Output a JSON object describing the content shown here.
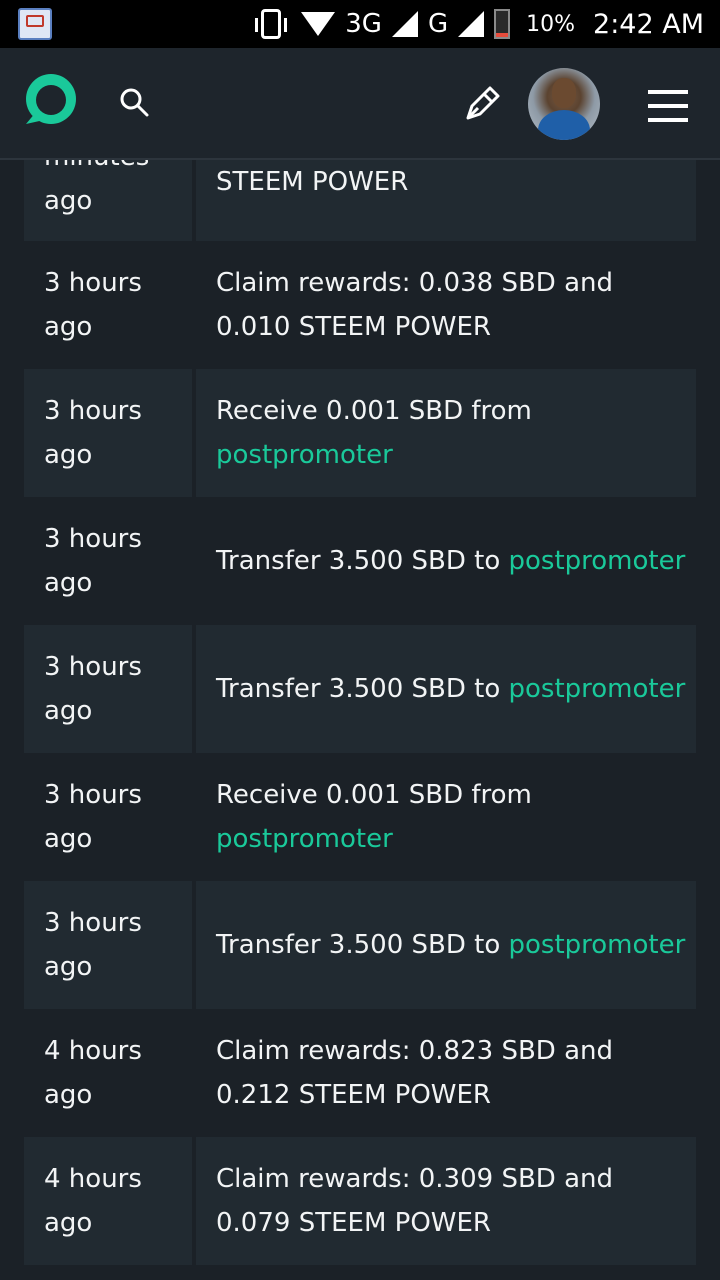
{
  "status_bar": {
    "network": "3G",
    "network2": "G",
    "battery": "10%",
    "time": "2:42 AM"
  },
  "header": {
    "logo_icon": "steemit-logo-icon",
    "accent": "#1ac99a"
  },
  "transactions": [
    {
      "time": "minutes ago",
      "text": "STEEM POWER",
      "link": "",
      "alt": true
    },
    {
      "time": "3 hours ago",
      "text": "Claim rewards: 0.038 SBD and 0.010 STEEM POWER",
      "link": "",
      "alt": false
    },
    {
      "time": "3 hours ago",
      "text": "Receive 0.001 SBD from ",
      "link": "postpromoter",
      "alt": true
    },
    {
      "time": "3 hours ago",
      "text": "Transfer 3.500 SBD to ",
      "link": "postpromoter",
      "alt": false
    },
    {
      "time": "3 hours ago",
      "text": "Transfer 3.500 SBD to ",
      "link": "postpromoter",
      "alt": true
    },
    {
      "time": "3 hours ago",
      "text": "Receive 0.001 SBD from ",
      "link": "postpromoter",
      "alt": false
    },
    {
      "time": "3 hours ago",
      "text": "Transfer 3.500 SBD to ",
      "link": "postpromoter",
      "alt": true
    },
    {
      "time": "4 hours ago",
      "text": "Claim rewards: 0.823 SBD and 0.212 STEEM POWER",
      "link": "",
      "alt": false
    },
    {
      "time": "4 hours ago",
      "text": "Claim rewards: 0.309 SBD and 0.079 STEEM POWER",
      "link": "",
      "alt": true
    }
  ]
}
